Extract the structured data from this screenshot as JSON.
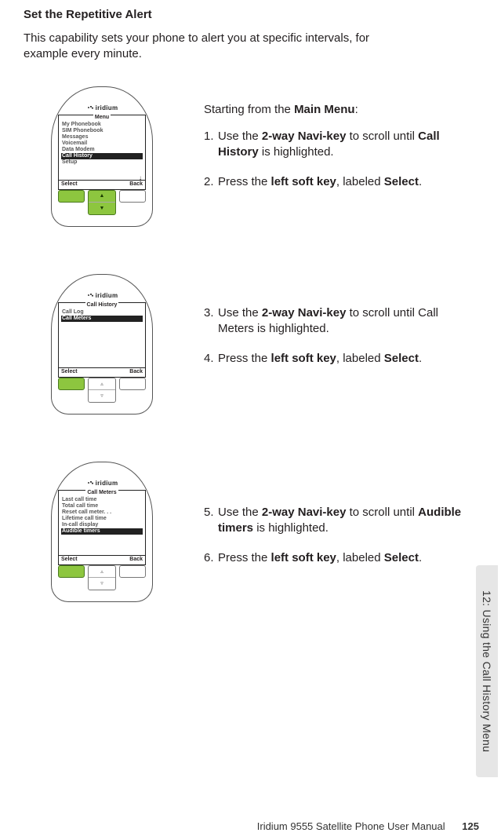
{
  "heading": "Set the Repetitive Alert",
  "intro": "This capability sets your phone to alert you at specific intervals, for example every minute.",
  "brand": "iridium",
  "softkeys": {
    "left": "Select",
    "right": "Back"
  },
  "phone1": {
    "title": "Menu",
    "items": [
      "My Phonebook",
      "SIM Phonebook",
      "Messages",
      "Voicemail",
      "Data Modem",
      "Call History",
      "Setup"
    ],
    "highlight": 5,
    "showArrow": true,
    "hlNavi": true,
    "hlLeftKey": true
  },
  "phone2": {
    "title": "Call History",
    "items": [
      "Call Log",
      "Call Meters"
    ],
    "highlight": 1,
    "showArrow": false,
    "hlNavi": false,
    "hlLeftKey": true
  },
  "phone3": {
    "title": "Call Meters",
    "items": [
      "Last call time",
      "Total call time",
      "Reset call meter. . .",
      "Lifetime call time",
      "In-call display",
      "Audible timers"
    ],
    "highlight": 5,
    "showArrow": false,
    "hlNavi": false,
    "hlLeftKey": true
  },
  "block1": {
    "lead_a": "Starting from the ",
    "lead_b": "Main Menu",
    "lead_c": ":",
    "s1n": "1.",
    "s1a": "Use the ",
    "s1b": "2-way Navi-key",
    "s1c": " to scroll until ",
    "s1d": "Call History",
    "s1e": " is highlighted.",
    "s2n": "2.",
    "s2a": "Press the ",
    "s2b": "left soft key",
    "s2c": ", labeled ",
    "s2d": "Select",
    "s2e": "."
  },
  "block2": {
    "s3n": "3.",
    "s3a": "Use the ",
    "s3b": "2-way Navi-key",
    "s3c": " to scroll until Call Meters is highlighted.",
    "s4n": "4.",
    "s4a": "Press the ",
    "s4b": "left soft key",
    "s4c": ", labeled ",
    "s4d": "Select",
    "s4e": "."
  },
  "block3": {
    "s5n": "5.",
    "s5a": "Use the ",
    "s5b": "2-way Navi-key",
    "s5c": " to scroll until ",
    "s5d": "Audible timers",
    "s5e": " is highlighted.",
    "s6n": "6.",
    "s6a": "Press the ",
    "s6b": "left soft key",
    "s6c": ", labeled ",
    "s6d": "Select",
    "s6e": "."
  },
  "sidetab": "12: Using the Call History Menu",
  "footer_text": "Iridium 9555 Satellite Phone User Manual",
  "footer_page": "125"
}
